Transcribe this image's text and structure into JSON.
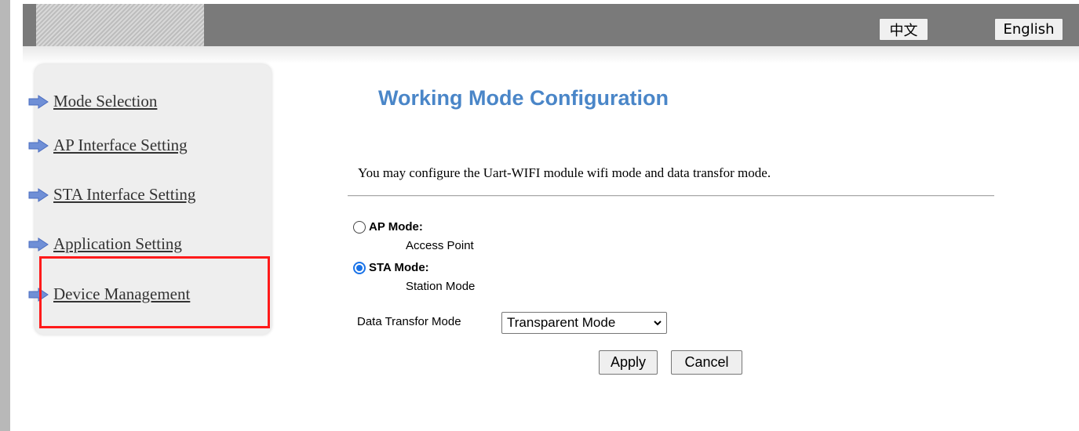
{
  "header": {
    "lang_zh": "中文",
    "lang_en": "English"
  },
  "sidebar": {
    "items": [
      {
        "label": "Mode Selection",
        "icon": "arrow-right-icon"
      },
      {
        "label": "AP Interface Setting",
        "icon": "arrow-right-icon"
      },
      {
        "label": "STA Interface Setting",
        "icon": "arrow-right-icon"
      },
      {
        "label": "Application Setting",
        "icon": "arrow-right-icon"
      },
      {
        "label": "Device Management",
        "icon": "arrow-right-icon"
      }
    ],
    "highlighted_item": "Device Management"
  },
  "main": {
    "title": "Working Mode Configuration",
    "description": "You may configure the Uart-WIFI module wifi mode and data transfor mode.",
    "modes": [
      {
        "label": "AP Mode:",
        "desc": "Access Point",
        "checked": false
      },
      {
        "label": "STA Mode:",
        "desc": "Station Mode",
        "checked": true
      }
    ],
    "transfer_label": "Data Transfor Mode",
    "transfer_value": "Transparent Mode",
    "apply_label": "Apply",
    "cancel_label": "Cancel"
  },
  "colors": {
    "title": "#4a86c8",
    "highlight": "#ff1a1a",
    "radio_checked": "#1a73e8",
    "topbar": "#7a7a7a"
  }
}
